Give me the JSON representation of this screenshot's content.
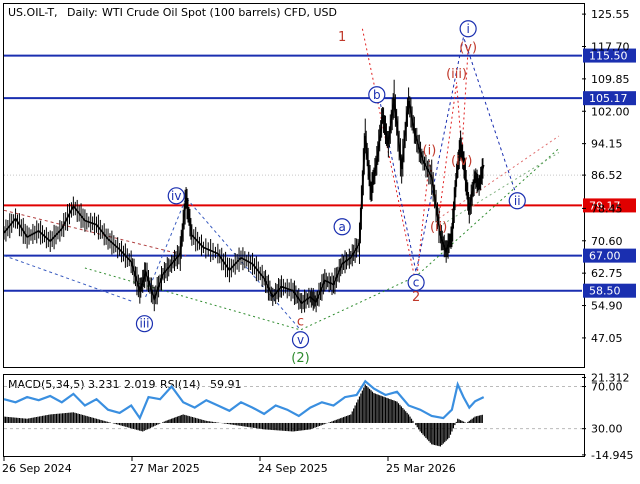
{
  "header": {
    "symbol": "US.OIL-T,",
    "timeframe": "Daily:",
    "instrument": "WTI Crude Oil Spot (100 barrels) CFD, USD"
  },
  "chart_data": [
    {
      "type": "line",
      "title": "WTI Crude Oil Spot (100 barrels) CFD, USD",
      "ylim": [
        40.0,
        128.0
      ],
      "y_ticks": [
        "125.55",
        "117.70",
        "109.85",
        "102.00",
        "94.15",
        "86.52",
        "78.45",
        "70.60",
        "62.75",
        "54.90",
        "47.05"
      ],
      "current_price": 86.52,
      "x_ticks": [
        "26 Sep 2024",
        "27 Mar 2025",
        "24 Sep 2025",
        "25 Mar 2026"
      ],
      "price_path": [
        [
          0,
          72.5
        ],
        [
          0.02,
          76
        ],
        [
          0.04,
          71.5
        ],
        [
          0.06,
          73
        ],
        [
          0.08,
          70.5
        ],
        [
          0.1,
          73.5
        ],
        [
          0.12,
          79
        ],
        [
          0.14,
          75.5
        ],
        [
          0.16,
          74.5
        ],
        [
          0.18,
          71
        ],
        [
          0.2,
          68.5
        ],
        [
          0.22,
          65.5
        ],
        [
          0.235,
          58.5
        ],
        [
          0.245,
          63
        ],
        [
          0.26,
          56.5
        ],
        [
          0.275,
          62.5
        ],
        [
          0.29,
          65
        ],
        [
          0.305,
          67.5
        ],
        [
          0.315,
          81
        ],
        [
          0.325,
          72
        ],
        [
          0.345,
          69
        ],
        [
          0.37,
          67.5
        ],
        [
          0.39,
          63.5
        ],
        [
          0.41,
          66.5
        ],
        [
          0.43,
          65
        ],
        [
          0.45,
          61.5
        ],
        [
          0.465,
          57
        ],
        [
          0.48,
          59.5
        ],
        [
          0.5,
          58.5
        ],
        [
          0.515,
          55.5
        ],
        [
          0.53,
          57
        ],
        [
          0.54,
          55.8
        ],
        [
          0.555,
          61
        ],
        [
          0.57,
          60
        ],
        [
          0.585,
          65
        ],
        [
          0.6,
          66.5
        ],
        [
          0.615,
          70
        ],
        [
          0.625,
          96
        ],
        [
          0.635,
          82.5
        ],
        [
          0.645,
          90
        ],
        [
          0.655,
          101
        ],
        [
          0.665,
          94
        ],
        [
          0.675,
          105
        ],
        [
          0.688,
          88
        ],
        [
          0.7,
          104.5
        ],
        [
          0.712,
          96
        ],
        [
          0.725,
          90
        ],
        [
          0.74,
          86
        ],
        [
          0.755,
          72
        ],
        [
          0.765,
          68
        ],
        [
          0.775,
          72
        ],
        [
          0.783,
          86.5
        ],
        [
          0.79,
          94
        ],
        [
          0.797,
          88
        ],
        [
          0.805,
          78
        ],
        [
          0.815,
          86
        ],
        [
          0.822,
          84
        ],
        [
          0.83,
          89
        ]
      ],
      "horizontal_levels": [
        {
          "price": 115.5,
          "label": "115.50",
          "color": "#1a2fb0"
        },
        {
          "price": 105.17,
          "label": "105.17",
          "color": "#1a2fb0"
        },
        {
          "price": 79.17,
          "label": "79.17",
          "color": "#e00000"
        },
        {
          "price": 67.0,
          "label": "67.00",
          "color": "#1a2fb0"
        },
        {
          "price": 58.5,
          "label": "58.50",
          "color": "#1a2fb0"
        }
      ],
      "wave_labels": [
        {
          "text": "1",
          "style": "red",
          "t": 0.585,
          "price": 120.0
        },
        {
          "text": "iv",
          "style": "blue-circle",
          "t": 0.298,
          "price": 81.5
        },
        {
          "text": "iii",
          "style": "blue-circle",
          "t": 0.243,
          "price": 50.5
        },
        {
          "text": "c",
          "style": "red",
          "t": 0.513,
          "price": 51.0
        },
        {
          "text": "v",
          "style": "blue-circle",
          "t": 0.513,
          "price": 46.6
        },
        {
          "text": "(2)",
          "style": "green",
          "t": 0.513,
          "price": 42.2
        },
        {
          "text": "a",
          "style": "blue-circle",
          "t": 0.585,
          "price": 74.0
        },
        {
          "text": "b",
          "style": "blue-circle",
          "t": 0.645,
          "price": 106.0
        },
        {
          "text": "c",
          "style": "blue-circle",
          "t": 0.713,
          "price": 60.5
        },
        {
          "text": "2",
          "style": "red",
          "t": 0.713,
          "price": 57.0
        },
        {
          "text": "(i)",
          "style": "red",
          "t": 0.736,
          "price": 92.5
        },
        {
          "text": "(ii)",
          "style": "red",
          "t": 0.752,
          "price": 74.0
        },
        {
          "text": "(iii)",
          "style": "red",
          "t": 0.783,
          "price": 111.0
        },
        {
          "text": "(iv)",
          "style": "red",
          "t": 0.792,
          "price": 90.0
        },
        {
          "text": "(v)",
          "style": "red",
          "t": 0.803,
          "price": 117.5
        },
        {
          "text": "i",
          "style": "blue-circle",
          "t": 0.803,
          "price": 122.0
        },
        {
          "text": "ii",
          "style": "blue-circle",
          "t": 0.888,
          "price": 80.3
        }
      ]
    },
    {
      "type": "line",
      "title": "MACD(5,34,5) 3.231 2.019 RSI(14) 59.91",
      "macd_params": "MACD(5,34,5)",
      "macd_main": 3.231,
      "macd_signal": 2.019,
      "rsi_params": "RSI(14)",
      "rsi": 59.91,
      "y_ticks": [
        "21.312",
        "70.00",
        "30.00",
        "-14.945"
      ],
      "rsi_path": [
        [
          0,
          58
        ],
        [
          0.02,
          55
        ],
        [
          0.04,
          60
        ],
        [
          0.06,
          57
        ],
        [
          0.08,
          61
        ],
        [
          0.1,
          55
        ],
        [
          0.12,
          63
        ],
        [
          0.14,
          52
        ],
        [
          0.16,
          58
        ],
        [
          0.18,
          48
        ],
        [
          0.2,
          45
        ],
        [
          0.22,
          52
        ],
        [
          0.235,
          40
        ],
        [
          0.25,
          60
        ],
        [
          0.27,
          58
        ],
        [
          0.29,
          70
        ],
        [
          0.31,
          55
        ],
        [
          0.33,
          50
        ],
        [
          0.35,
          57
        ],
        [
          0.37,
          52
        ],
        [
          0.39,
          47
        ],
        [
          0.41,
          55
        ],
        [
          0.43,
          50
        ],
        [
          0.45,
          44
        ],
        [
          0.47,
          52
        ],
        [
          0.49,
          48
        ],
        [
          0.51,
          42
        ],
        [
          0.53,
          50
        ],
        [
          0.55,
          55
        ],
        [
          0.57,
          52
        ],
        [
          0.59,
          60
        ],
        [
          0.61,
          62
        ],
        [
          0.625,
          75
        ],
        [
          0.64,
          68
        ],
        [
          0.66,
          62
        ],
        [
          0.68,
          65
        ],
        [
          0.7,
          52
        ],
        [
          0.72,
          48
        ],
        [
          0.74,
          42
        ],
        [
          0.76,
          40
        ],
        [
          0.775,
          48
        ],
        [
          0.785,
          72
        ],
        [
          0.795,
          60
        ],
        [
          0.805,
          50
        ],
        [
          0.815,
          56
        ],
        [
          0.83,
          60
        ]
      ],
      "macd_hist": [
        [
          0,
          3
        ],
        [
          0.04,
          2
        ],
        [
          0.08,
          4
        ],
        [
          0.12,
          5
        ],
        [
          0.16,
          2
        ],
        [
          0.2,
          -1
        ],
        [
          0.24,
          -4
        ],
        [
          0.28,
          1
        ],
        [
          0.31,
          4
        ],
        [
          0.35,
          1
        ],
        [
          0.4,
          -1
        ],
        [
          0.45,
          -3
        ],
        [
          0.5,
          -4
        ],
        [
          0.53,
          -3
        ],
        [
          0.57,
          1
        ],
        [
          0.6,
          4
        ],
        [
          0.625,
          18
        ],
        [
          0.64,
          14
        ],
        [
          0.66,
          12
        ],
        [
          0.68,
          10
        ],
        [
          0.7,
          4
        ],
        [
          0.72,
          -4
        ],
        [
          0.74,
          -10
        ],
        [
          0.755,
          -11
        ],
        [
          0.77,
          -7
        ],
        [
          0.785,
          2
        ],
        [
          0.8,
          0
        ],
        [
          0.815,
          3
        ],
        [
          0.83,
          4
        ]
      ]
    }
  ]
}
